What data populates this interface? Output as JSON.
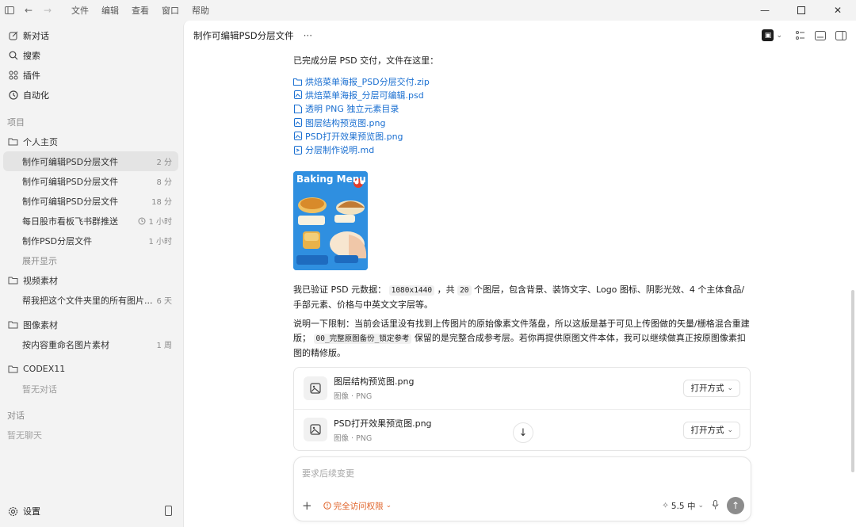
{
  "menubar": {
    "items": [
      "文件",
      "编辑",
      "查看",
      "窗口",
      "帮助"
    ]
  },
  "sidebar": {
    "nav": [
      {
        "label": "新对话",
        "icon": "edit-icon"
      },
      {
        "label": "搜索",
        "icon": "search-icon"
      },
      {
        "label": "插件",
        "icon": "plugin-icon"
      },
      {
        "label": "自动化",
        "icon": "clock-icon"
      }
    ],
    "projects_label": "项目",
    "folders": [
      {
        "name": "个人主页",
        "threads": [
          {
            "name": "制作可编辑PSD分层文件",
            "time": "2 分",
            "active": true
          },
          {
            "name": "制作可编辑PSD分层文件",
            "time": "8 分"
          },
          {
            "name": "制作可编辑PSD分层文件",
            "time": "18 分"
          },
          {
            "name": "每日股市看板飞书群推送",
            "time": "1 小时",
            "scheduled": true
          },
          {
            "name": "制作PSD分层文件",
            "time": "1 小时"
          }
        ],
        "expand": "展开显示"
      },
      {
        "name": "视频素材",
        "threads": [
          {
            "name": "帮我把这个文件夹里的所有图片...",
            "time": "6 天"
          }
        ]
      },
      {
        "name": "图像素材",
        "threads": [
          {
            "name": "按内容重命名图片素材",
            "time": "1 周"
          }
        ]
      },
      {
        "name": "CODEX11",
        "empty": "暂无对话"
      }
    ],
    "chats_label": "对话",
    "chats_empty": "暂无聊天",
    "settings": "设置"
  },
  "header": {
    "title": "制作可编辑PSD分层文件",
    "more": "···"
  },
  "message": {
    "intro": "已完成分层 PSD 交付，文件在这里：",
    "files": [
      {
        "name": "烘焙菜单海报_PSD分层交付.zip",
        "icon": "folder-icon"
      },
      {
        "name": "烘焙菜单海报_分层可编辑.psd",
        "icon": "image-file-icon"
      },
      {
        "name": "透明 PNG 独立元素目录",
        "icon": "document-icon"
      },
      {
        "name": "图层结构预览图.png",
        "icon": "image-file-icon"
      },
      {
        "name": "PSD打开效果预览图.png",
        "icon": "image-file-icon"
      },
      {
        "name": "分层制作说明.md",
        "icon": "markdown-file-icon"
      }
    ],
    "poster_title": "Baking Menu",
    "p1_a": "我已验证 PSD 元数据：",
    "p1_code1": "1080x1440",
    "p1_b": "，共",
    "p1_code2": "20",
    "p1_c": "个图层，包含背景、装饰文字、Logo 图标、阴影光效、4 个主体食品/手部元素、价格与中英文文字层等。",
    "p2_a": "说明一下限制：当前会话里没有找到上传图片的原始像素文件落盘，所以这版是基于可见上传图做的矢量/栅格混合重建版；",
    "p2_code": "00_完整原图备份_锁定参考",
    "p2_b": "保留的是完整合成参考层。若你再提供原图文件本体，我可以继续做真正按原图像素扣图的精修版。"
  },
  "attachments": [
    {
      "name": "图层结构预览图.png",
      "meta": "图像 · PNG",
      "action": "打开方式"
    },
    {
      "name": "PSD打开效果预览图.png",
      "meta": "图像 · PNG",
      "action": "打开方式"
    }
  ],
  "composer": {
    "placeholder": "要求后续变更",
    "access": "完全访问权限",
    "model": "5.5 中"
  },
  "colors": {
    "link": "#1a6fd1",
    "accent_warning": "#e0642a",
    "poster_bg": "#2f8fe0"
  }
}
